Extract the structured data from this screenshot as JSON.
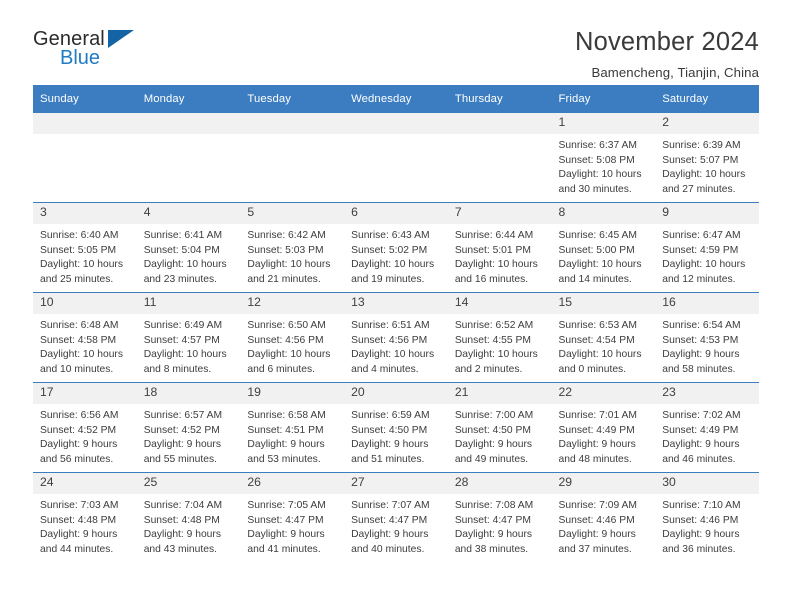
{
  "brand": {
    "name_part1": "General",
    "name_part2": "Blue",
    "flag_icon": "triangle-flag-icon",
    "accent_color": "#1464a5"
  },
  "header": {
    "title": "November 2024",
    "subtitle": "Bamencheng, Tianjin, China"
  },
  "theme": {
    "header_row_bg": "#3b7dc0",
    "daynum_bg": "#f1f1f1",
    "text_color": "#3d3d3d",
    "brand_blue": "#1f7bc4"
  },
  "calendar": {
    "weekday_headers": [
      "Sunday",
      "Monday",
      "Tuesday",
      "Wednesday",
      "Thursday",
      "Friday",
      "Saturday"
    ],
    "weeks": [
      [
        {
          "day": "",
          "empty": true,
          "sunrise": "",
          "sunset": "",
          "daylight_line1": "",
          "daylight_line2": ""
        },
        {
          "day": "",
          "empty": true,
          "sunrise": "",
          "sunset": "",
          "daylight_line1": "",
          "daylight_line2": ""
        },
        {
          "day": "",
          "empty": true,
          "sunrise": "",
          "sunset": "",
          "daylight_line1": "",
          "daylight_line2": ""
        },
        {
          "day": "",
          "empty": true,
          "sunrise": "",
          "sunset": "",
          "daylight_line1": "",
          "daylight_line2": ""
        },
        {
          "day": "",
          "empty": true,
          "sunrise": "",
          "sunset": "",
          "daylight_line1": "",
          "daylight_line2": ""
        },
        {
          "day": "1",
          "empty": false,
          "sunrise": "Sunrise: 6:37 AM",
          "sunset": "Sunset: 5:08 PM",
          "daylight_line1": "Daylight: 10 hours",
          "daylight_line2": "and 30 minutes."
        },
        {
          "day": "2",
          "empty": false,
          "sunrise": "Sunrise: 6:39 AM",
          "sunset": "Sunset: 5:07 PM",
          "daylight_line1": "Daylight: 10 hours",
          "daylight_line2": "and 27 minutes."
        }
      ],
      [
        {
          "day": "3",
          "empty": false,
          "sunrise": "Sunrise: 6:40 AM",
          "sunset": "Sunset: 5:05 PM",
          "daylight_line1": "Daylight: 10 hours",
          "daylight_line2": "and 25 minutes."
        },
        {
          "day": "4",
          "empty": false,
          "sunrise": "Sunrise: 6:41 AM",
          "sunset": "Sunset: 5:04 PM",
          "daylight_line1": "Daylight: 10 hours",
          "daylight_line2": "and 23 minutes."
        },
        {
          "day": "5",
          "empty": false,
          "sunrise": "Sunrise: 6:42 AM",
          "sunset": "Sunset: 5:03 PM",
          "daylight_line1": "Daylight: 10 hours",
          "daylight_line2": "and 21 minutes."
        },
        {
          "day": "6",
          "empty": false,
          "sunrise": "Sunrise: 6:43 AM",
          "sunset": "Sunset: 5:02 PM",
          "daylight_line1": "Daylight: 10 hours",
          "daylight_line2": "and 19 minutes."
        },
        {
          "day": "7",
          "empty": false,
          "sunrise": "Sunrise: 6:44 AM",
          "sunset": "Sunset: 5:01 PM",
          "daylight_line1": "Daylight: 10 hours",
          "daylight_line2": "and 16 minutes."
        },
        {
          "day": "8",
          "empty": false,
          "sunrise": "Sunrise: 6:45 AM",
          "sunset": "Sunset: 5:00 PM",
          "daylight_line1": "Daylight: 10 hours",
          "daylight_line2": "and 14 minutes."
        },
        {
          "day": "9",
          "empty": false,
          "sunrise": "Sunrise: 6:47 AM",
          "sunset": "Sunset: 4:59 PM",
          "daylight_line1": "Daylight: 10 hours",
          "daylight_line2": "and 12 minutes."
        }
      ],
      [
        {
          "day": "10",
          "empty": false,
          "sunrise": "Sunrise: 6:48 AM",
          "sunset": "Sunset: 4:58 PM",
          "daylight_line1": "Daylight: 10 hours",
          "daylight_line2": "and 10 minutes."
        },
        {
          "day": "11",
          "empty": false,
          "sunrise": "Sunrise: 6:49 AM",
          "sunset": "Sunset: 4:57 PM",
          "daylight_line1": "Daylight: 10 hours",
          "daylight_line2": "and 8 minutes."
        },
        {
          "day": "12",
          "empty": false,
          "sunrise": "Sunrise: 6:50 AM",
          "sunset": "Sunset: 4:56 PM",
          "daylight_line1": "Daylight: 10 hours",
          "daylight_line2": "and 6 minutes."
        },
        {
          "day": "13",
          "empty": false,
          "sunrise": "Sunrise: 6:51 AM",
          "sunset": "Sunset: 4:56 PM",
          "daylight_line1": "Daylight: 10 hours",
          "daylight_line2": "and 4 minutes."
        },
        {
          "day": "14",
          "empty": false,
          "sunrise": "Sunrise: 6:52 AM",
          "sunset": "Sunset: 4:55 PM",
          "daylight_line1": "Daylight: 10 hours",
          "daylight_line2": "and 2 minutes."
        },
        {
          "day": "15",
          "empty": false,
          "sunrise": "Sunrise: 6:53 AM",
          "sunset": "Sunset: 4:54 PM",
          "daylight_line1": "Daylight: 10 hours",
          "daylight_line2": "and 0 minutes."
        },
        {
          "day": "16",
          "empty": false,
          "sunrise": "Sunrise: 6:54 AM",
          "sunset": "Sunset: 4:53 PM",
          "daylight_line1": "Daylight: 9 hours",
          "daylight_line2": "and 58 minutes."
        }
      ],
      [
        {
          "day": "17",
          "empty": false,
          "sunrise": "Sunrise: 6:56 AM",
          "sunset": "Sunset: 4:52 PM",
          "daylight_line1": "Daylight: 9 hours",
          "daylight_line2": "and 56 minutes."
        },
        {
          "day": "18",
          "empty": false,
          "sunrise": "Sunrise: 6:57 AM",
          "sunset": "Sunset: 4:52 PM",
          "daylight_line1": "Daylight: 9 hours",
          "daylight_line2": "and 55 minutes."
        },
        {
          "day": "19",
          "empty": false,
          "sunrise": "Sunrise: 6:58 AM",
          "sunset": "Sunset: 4:51 PM",
          "daylight_line1": "Daylight: 9 hours",
          "daylight_line2": "and 53 minutes."
        },
        {
          "day": "20",
          "empty": false,
          "sunrise": "Sunrise: 6:59 AM",
          "sunset": "Sunset: 4:50 PM",
          "daylight_line1": "Daylight: 9 hours",
          "daylight_line2": "and 51 minutes."
        },
        {
          "day": "21",
          "empty": false,
          "sunrise": "Sunrise: 7:00 AM",
          "sunset": "Sunset: 4:50 PM",
          "daylight_line1": "Daylight: 9 hours",
          "daylight_line2": "and 49 minutes."
        },
        {
          "day": "22",
          "empty": false,
          "sunrise": "Sunrise: 7:01 AM",
          "sunset": "Sunset: 4:49 PM",
          "daylight_line1": "Daylight: 9 hours",
          "daylight_line2": "and 48 minutes."
        },
        {
          "day": "23",
          "empty": false,
          "sunrise": "Sunrise: 7:02 AM",
          "sunset": "Sunset: 4:49 PM",
          "daylight_line1": "Daylight: 9 hours",
          "daylight_line2": "and 46 minutes."
        }
      ],
      [
        {
          "day": "24",
          "empty": false,
          "sunrise": "Sunrise: 7:03 AM",
          "sunset": "Sunset: 4:48 PM",
          "daylight_line1": "Daylight: 9 hours",
          "daylight_line2": "and 44 minutes."
        },
        {
          "day": "25",
          "empty": false,
          "sunrise": "Sunrise: 7:04 AM",
          "sunset": "Sunset: 4:48 PM",
          "daylight_line1": "Daylight: 9 hours",
          "daylight_line2": "and 43 minutes."
        },
        {
          "day": "26",
          "empty": false,
          "sunrise": "Sunrise: 7:05 AM",
          "sunset": "Sunset: 4:47 PM",
          "daylight_line1": "Daylight: 9 hours",
          "daylight_line2": "and 41 minutes."
        },
        {
          "day": "27",
          "empty": false,
          "sunrise": "Sunrise: 7:07 AM",
          "sunset": "Sunset: 4:47 PM",
          "daylight_line1": "Daylight: 9 hours",
          "daylight_line2": "and 40 minutes."
        },
        {
          "day": "28",
          "empty": false,
          "sunrise": "Sunrise: 7:08 AM",
          "sunset": "Sunset: 4:47 PM",
          "daylight_line1": "Daylight: 9 hours",
          "daylight_line2": "and 38 minutes."
        },
        {
          "day": "29",
          "empty": false,
          "sunrise": "Sunrise: 7:09 AM",
          "sunset": "Sunset: 4:46 PM",
          "daylight_line1": "Daylight: 9 hours",
          "daylight_line2": "and 37 minutes."
        },
        {
          "day": "30",
          "empty": false,
          "sunrise": "Sunrise: 7:10 AM",
          "sunset": "Sunset: 4:46 PM",
          "daylight_line1": "Daylight: 9 hours",
          "daylight_line2": "and 36 minutes."
        }
      ]
    ]
  }
}
